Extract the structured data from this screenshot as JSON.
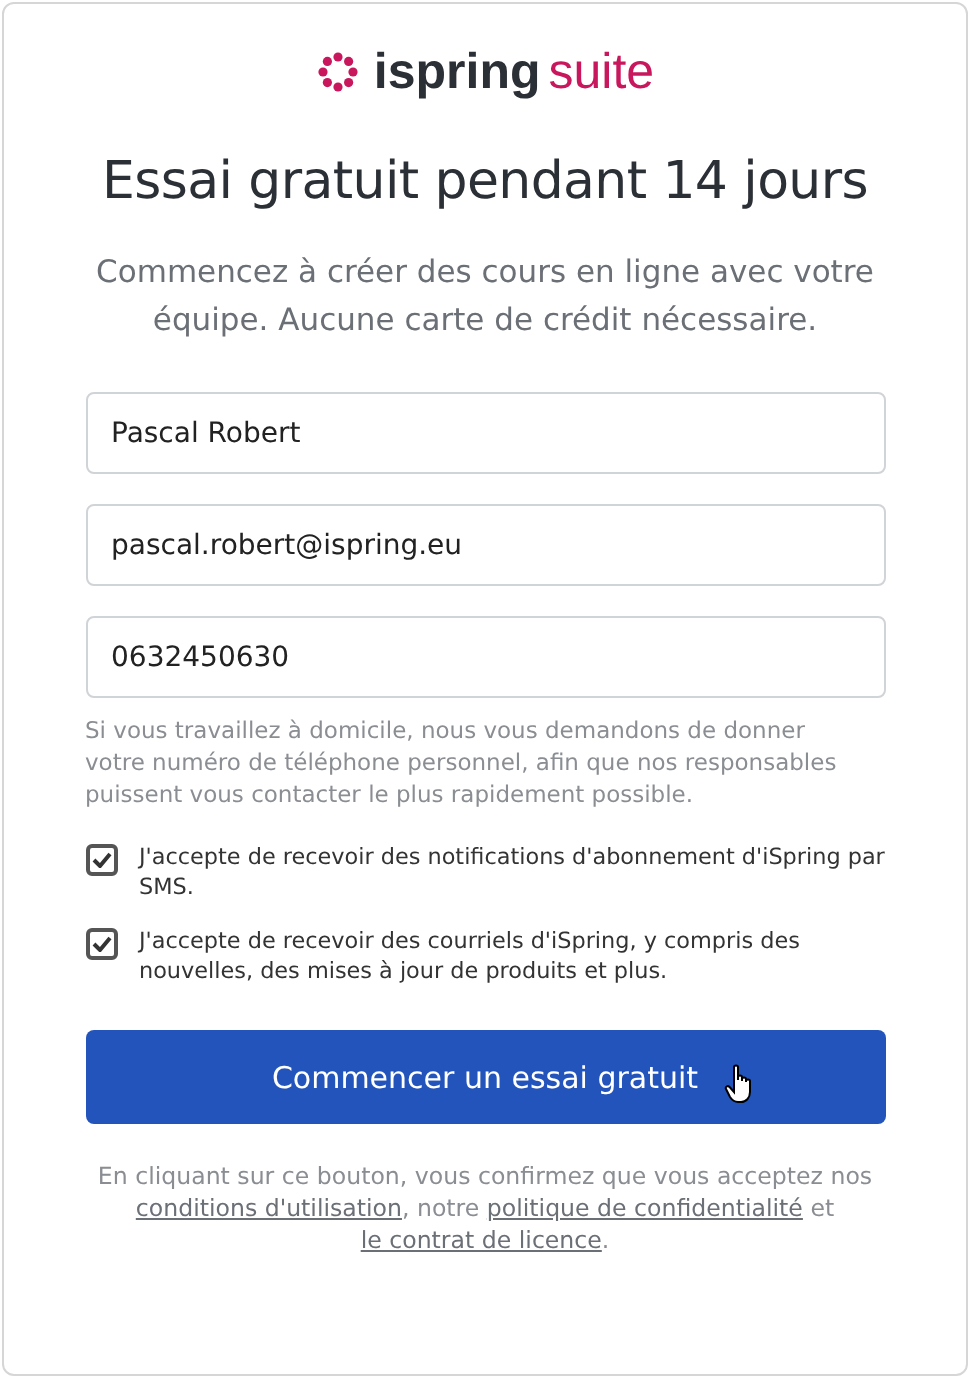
{
  "logo": {
    "brand": "ispring",
    "product": "suite"
  },
  "title": "Essai gratuit pendant 14 jours",
  "subtitle": "Commencez à créer des cours en ligne avec votre équipe. Aucune carte de crédit nécessaire.",
  "fields": [
    {
      "value": "Pascal Robert"
    },
    {
      "value": "pascal.robert@ispring.eu"
    },
    {
      "value": "0632450630"
    }
  ],
  "hint": "Si vous travaillez à domicile, nous vous demandons de donner votre numéro de téléphone personnel, afin que nos responsables puissent vous contacter le plus rapidement possible.",
  "checkboxes": [
    {
      "label": "J'accepte de recevoir des notifications d'abonnement d'iSpring par SMS.",
      "checked": true
    },
    {
      "label": "J'accepte de recevoir des courriels d'iSpring, y compris des nouvelles, des mises à jour de produits et plus.",
      "checked": true
    }
  ],
  "submit_button": "Commencer un essai gratuit",
  "legal": [
    {
      "kind": "text",
      "text": "En cliquant sur ce bouton, vous confirmez que vous acceptez nos "
    },
    {
      "kind": "link",
      "text": "conditions d'utilisation"
    },
    {
      "kind": "text",
      "text": ", notre "
    },
    {
      "kind": "link",
      "text": "politique de confidentialité"
    },
    {
      "kind": "text",
      "text": " et "
    },
    {
      "kind": "link",
      "text": "le contrat de licence"
    },
    {
      "kind": "text",
      "text": "."
    }
  ]
}
